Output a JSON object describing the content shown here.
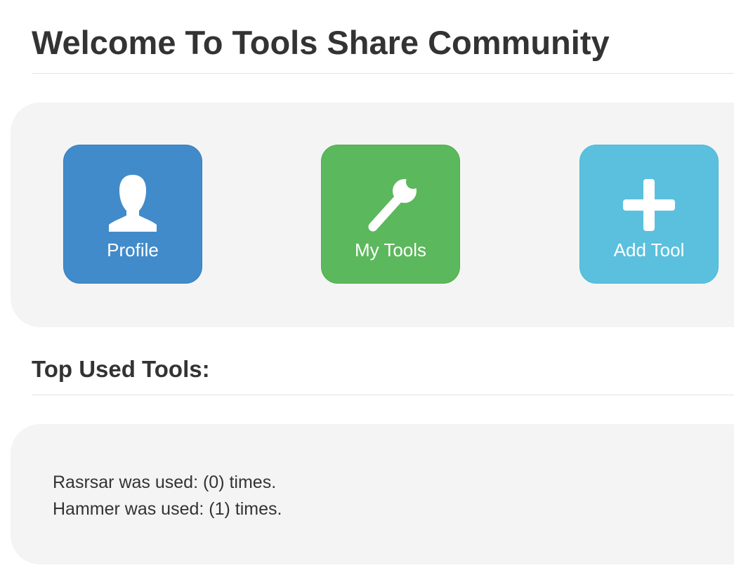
{
  "page": {
    "title": "Welcome To Tools Share Community"
  },
  "actions": [
    {
      "label": "Profile",
      "icon": "user-icon",
      "color": "#428bca"
    },
    {
      "label": "My Tools",
      "icon": "wrench-icon",
      "color": "#5cb85c"
    },
    {
      "label": "Add Tool",
      "icon": "plus-icon",
      "color": "#5bc0de"
    }
  ],
  "top_used": {
    "heading": "Top Used Tools:",
    "items": [
      "Rasrsar was used: (0) times.",
      "Hammer was used: (1) times."
    ]
  }
}
